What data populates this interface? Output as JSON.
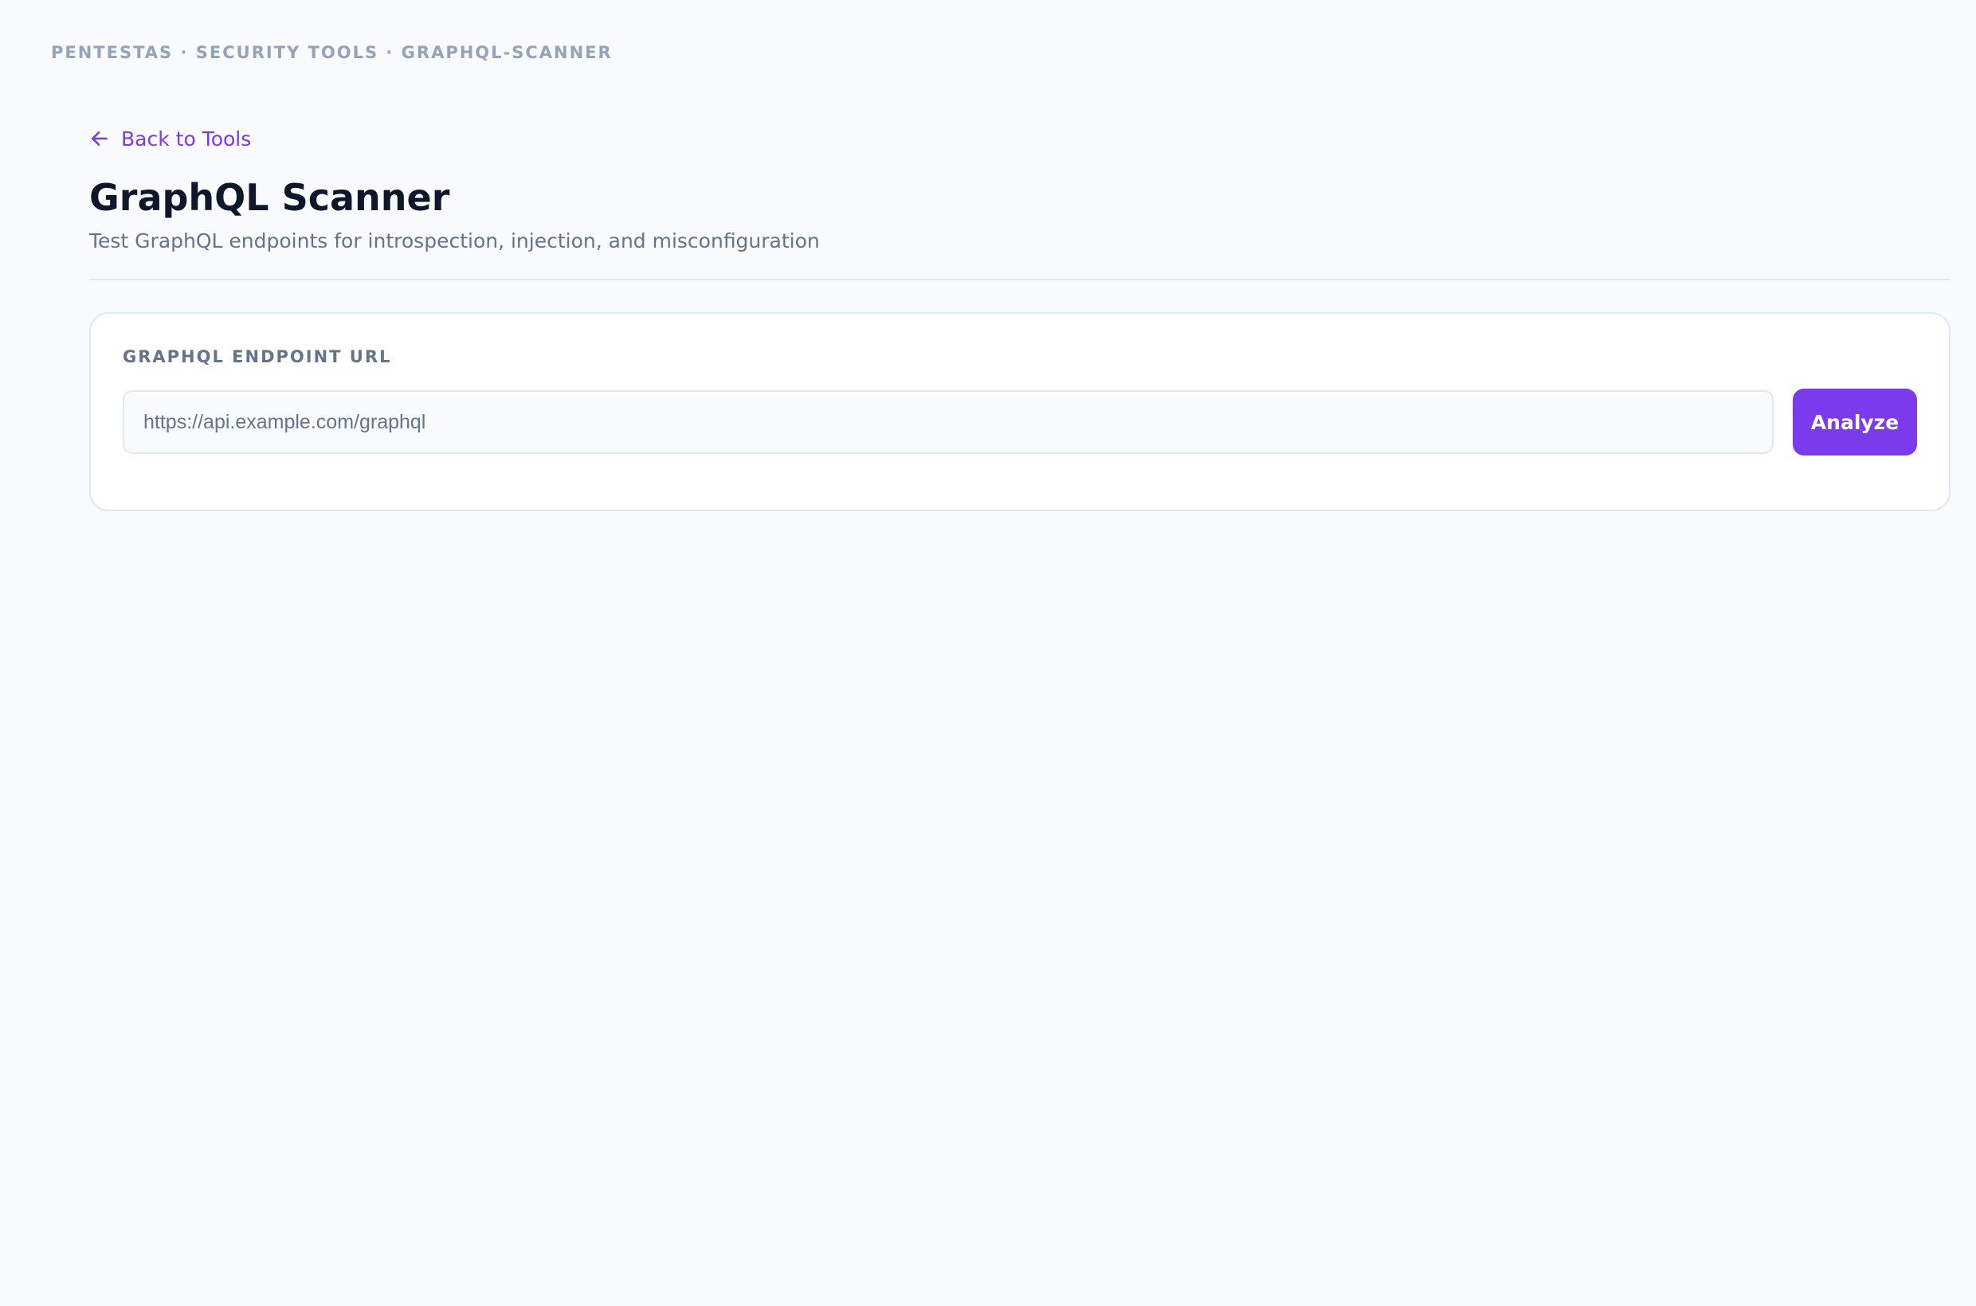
{
  "breadcrumb": "PENTESTAS · SECURITY TOOLS · GRAPHQL-SCANNER",
  "back_link": {
    "label": "Back to Tools",
    "icon": "arrow-left-icon"
  },
  "header": {
    "title": "GraphQL Scanner",
    "subtitle": "Test GraphQL endpoints for introspection, injection, and misconfiguration"
  },
  "form": {
    "label": "GRAPHQL ENDPOINT URL",
    "input_placeholder": "https://api.example.com/graphql",
    "input_value": "",
    "submit_label": "Analyze"
  },
  "colors": {
    "accent": "#7c3aed",
    "background": "#f8fafc",
    "title": "#0f172a",
    "muted": "#64748b"
  }
}
